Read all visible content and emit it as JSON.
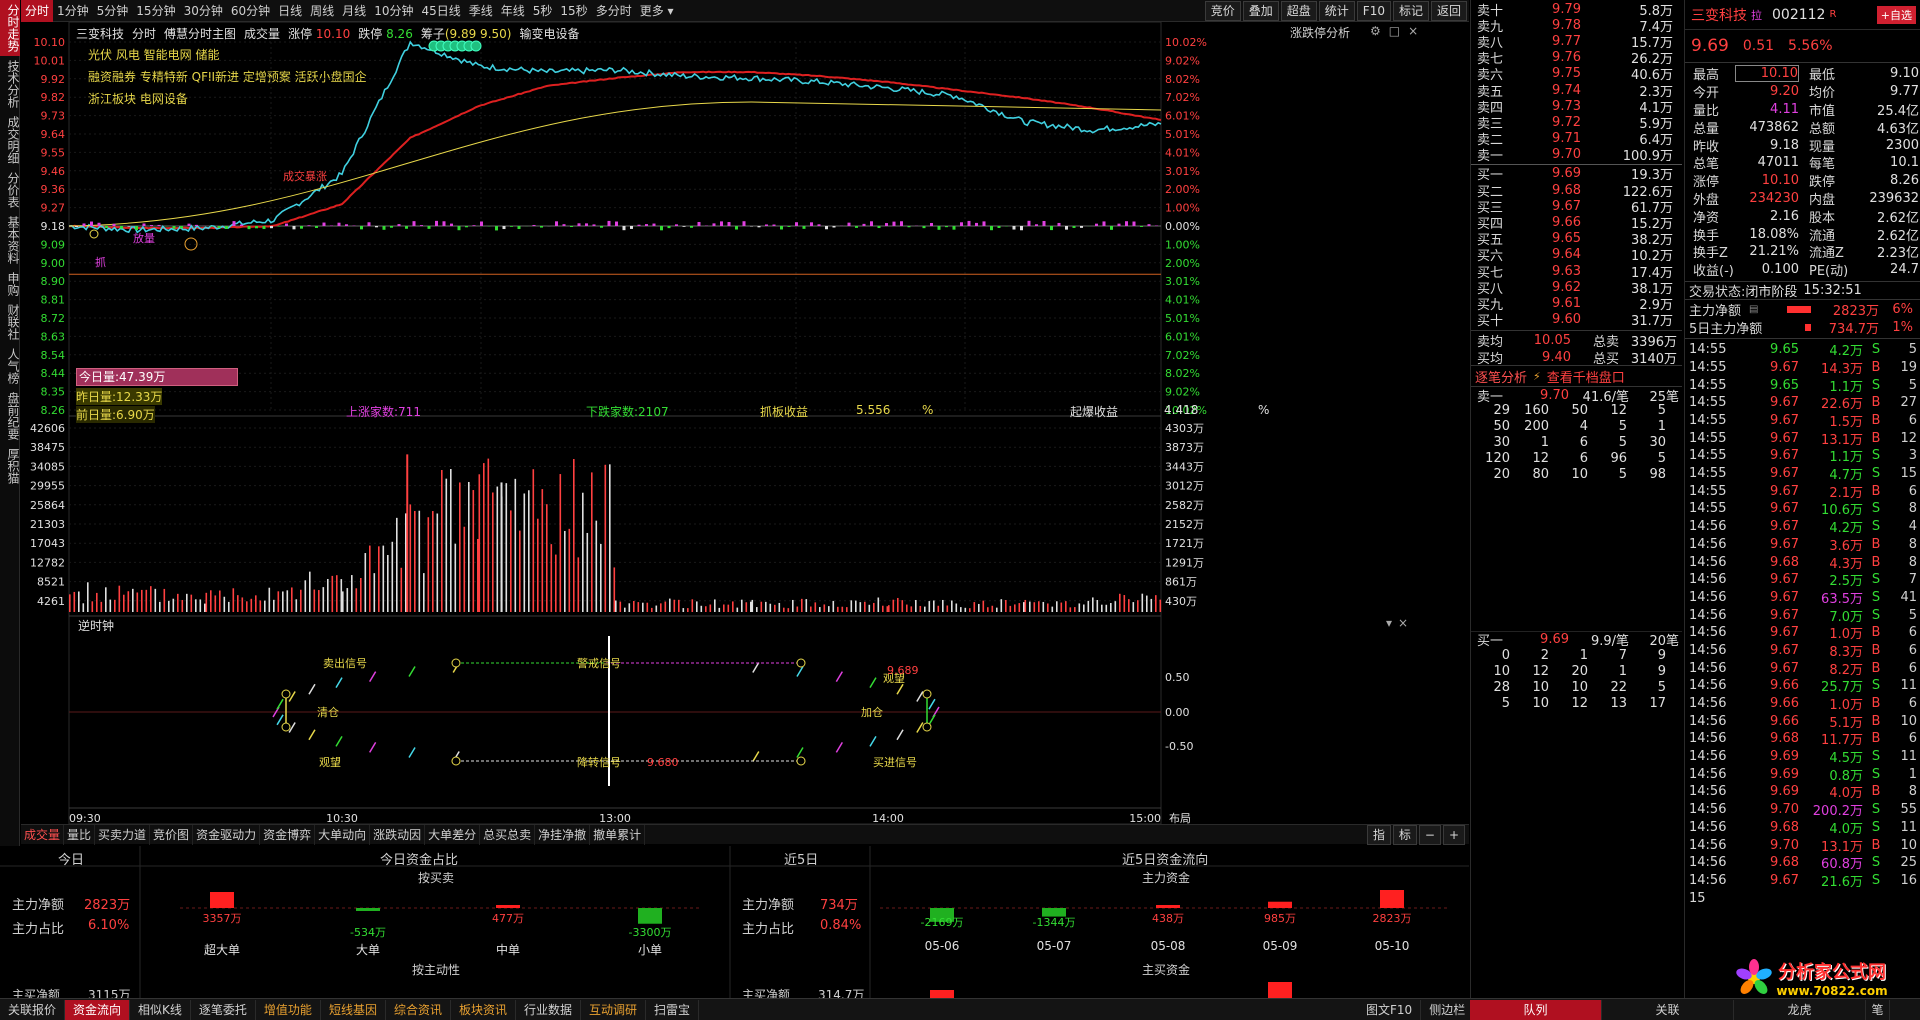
{
  "vtabs": [
    {
      "label": "分时走势",
      "active": true
    },
    {
      "label": "技术分析"
    },
    {
      "label": "成交明细"
    },
    {
      "label": "分价表"
    },
    {
      "label": "基本资料"
    },
    {
      "label": "申购"
    },
    {
      "label": "财联社"
    },
    {
      "label": "人气榜"
    },
    {
      "label": "盘前纪要"
    },
    {
      "label": "厚积猫"
    }
  ],
  "periods": [
    {
      "label": "分时",
      "active": true
    },
    {
      "label": "1分钟"
    },
    {
      "label": "5分钟"
    },
    {
      "label": "15分钟"
    },
    {
      "label": "30分钟"
    },
    {
      "label": "60分钟"
    },
    {
      "label": "日线"
    },
    {
      "label": "周线"
    },
    {
      "label": "月线"
    },
    {
      "label": "10分钟"
    },
    {
      "label": "45日线"
    },
    {
      "label": "季线"
    },
    {
      "label": "年线"
    },
    {
      "label": "5秒"
    },
    {
      "label": "15秒"
    },
    {
      "label": "多分时"
    },
    {
      "label": "更多 ▾"
    }
  ],
  "right_buttons": [
    "竞价",
    "叠加",
    "超盘",
    "统计",
    "F10",
    "标记",
    "返回"
  ],
  "info": {
    "name": "三变科技",
    "mode": "分时",
    "main": "傅慧分时主图",
    "vol": "成交量",
    "zt_label": "涨停",
    "zt": "10.10",
    "dt_label": "跌停",
    "dt": "8.26",
    "chip_label": "筹子",
    "chip": "(9.89 9.50)",
    "industry": "输变电设备",
    "zdt": "涨跌停分析"
  },
  "tags": [
    "光伏 风电 智能电网 储能",
    "融资融券 专精特新 QFII新进 定增预案 活跃小盘国企",
    "浙江板块 电网设备"
  ],
  "chart_data": [
    {
      "type": "line",
      "title": "三变科技 分时",
      "x": [
        "09:30",
        "09:45",
        "10:00",
        "10:15",
        "10:30",
        "10:45",
        "11:00",
        "11:15",
        "11:30",
        "13:15",
        "13:30",
        "13:45",
        "14:00",
        "14:15",
        "14:30",
        "14:45",
        "15:00"
      ],
      "series": [
        {
          "name": "价格",
          "values": [
            9.18,
            9.16,
            9.17,
            9.21,
            9.44,
            10.1,
            9.98,
            9.95,
            9.96,
            9.93,
            9.92,
            9.9,
            9.87,
            9.83,
            9.7,
            9.66,
            9.69
          ]
        },
        {
          "name": "均价",
          "values": [
            9.18,
            9.17,
            9.17,
            9.18,
            9.29,
            9.62,
            9.78,
            9.88,
            9.92,
            9.95,
            9.95,
            9.93,
            9.9,
            9.86,
            9.82,
            9.77,
            9.71
          ]
        }
      ],
      "y_ticks": [
        "10.10",
        "10.01",
        "9.92",
        "9.82",
        "9.73",
        "9.64",
        "9.55",
        "9.46",
        "9.36",
        "9.27",
        "9.18",
        "9.09",
        "9.00",
        "8.90",
        "8.81",
        "8.72",
        "8.63",
        "8.54",
        "8.44",
        "8.35",
        "8.26"
      ],
      "y_pct_ticks": [
        "10.02%",
        "9.02%",
        "8.02%",
        "7.02%",
        "6.01%",
        "5.01%",
        "4.01%",
        "3.01%",
        "2.00%",
        "1.00%",
        "0.00%",
        "1.00%",
        "2.00%",
        "3.01%",
        "4.01%",
        "5.01%",
        "6.01%",
        "7.02%",
        "8.02%",
        "9.02%",
        "10.02%"
      ],
      "ylim": [
        8.26,
        10.1
      ]
    },
    {
      "type": "bar",
      "title": "成交量",
      "x": [
        "09:30",
        "10:00",
        "10:30",
        "11:00",
        "11:30",
        "13:00",
        "13:30",
        "14:00",
        "14:30",
        "15:00"
      ],
      "values": [
        6500,
        5200,
        9800,
        38000,
        31000,
        3000,
        2600,
        3100,
        2800,
        4800
      ],
      "y_ticks": [
        "42606",
        "38475",
        "34085",
        "29955",
        "25864",
        "21303",
        "17043",
        "12782",
        "8521",
        "4261"
      ],
      "y_right_ticks": [
        "4303万",
        "3873万",
        "3443万",
        "3012万",
        "2582万",
        "2152万",
        "1721万",
        "1291万",
        "861万",
        "430万"
      ]
    },
    {
      "type": "line",
      "title": "逆时钟",
      "y_ticks": [
        "0.50",
        "0.00",
        "-0.50"
      ]
    }
  ],
  "x_ticks": [
    "09:30",
    "10:30",
    "13:00",
    "14:00",
    "15:00"
  ],
  "x_right": "布局",
  "vol_labels": {
    "today": "今日量:47.39万",
    "yday": "昨日量:12.33万",
    "before": "前日量:6.90万"
  },
  "stats": {
    "up": "上涨家数:711",
    "down": "下跌家数:2107",
    "grab_label": "抓板收益",
    "grab": "5.556",
    "grab_unit": "%",
    "qb_label": "起爆收益",
    "qb": "4.418",
    "qb_unit": "%"
  },
  "osc": {
    "sell_sig": "卖出信号",
    "warn_sig": "警戒信号",
    "clear": "清仓",
    "add": "加仓",
    "watch1": "观望",
    "watch2": "观望",
    "down_sig": "降转信号",
    "buy_sig": "买进信号",
    "v1": "9.689",
    "v2": "9.680"
  },
  "chart_annotations": [
    "三变科技",
    "放量",
    "抓",
    "成交暴涨"
  ],
  "btabs": [
    {
      "label": "成交量",
      "active": true
    },
    {
      "label": "量比"
    },
    {
      "label": "买卖力道"
    },
    {
      "label": "竞价图"
    },
    {
      "label": "资金驱动力"
    },
    {
      "label": "资金博弈"
    },
    {
      "label": "大单动向"
    },
    {
      "label": "涨跌动因"
    },
    {
      "label": "大单差分"
    },
    {
      "label": "总买总卖"
    },
    {
      "label": "净挂净撤"
    },
    {
      "label": "撤单累计"
    }
  ],
  "btab_right": [
    "指",
    "标",
    "−",
    "+"
  ],
  "flow": {
    "today": "今日",
    "ratio_title": "今日资金占比",
    "by_buy": "按买卖",
    "by_active": "按主动性",
    "main_net_label": "主力净额",
    "main_net": "2823万",
    "main_pct_label": "主力占比",
    "main_pct": "6.10%",
    "bars": [
      {
        "label": "超大单",
        "value": "3357万"
      },
      {
        "label": "大单",
        "value": "-534万"
      },
      {
        "label": "中单",
        "value": "477万"
      },
      {
        "label": "小单",
        "value": "-3300万"
      }
    ],
    "d5": "近5日",
    "d5_flow": "近5日资金流向",
    "d5_main": "主力资金",
    "d5_net_label": "主力净额",
    "d5_net": "734万",
    "d5_pct_label": "主力占比",
    "d5_pct": "0.84%",
    "d5_bars": [
      {
        "label": "05-06",
        "value": "-2169万"
      },
      {
        "label": "05-07",
        "value": "-1344万"
      },
      {
        "label": "05-08",
        "value": "438万"
      },
      {
        "label": "05-09",
        "value": "985万"
      },
      {
        "label": "05-10",
        "value": "2823万"
      }
    ],
    "main_active": "主买资金",
    "partial1": "主买净额",
    "partial2": "3115万",
    "partial3": "主买净额",
    "partial4": "314.7万"
  },
  "statusbar": [
    {
      "label": "关联报价"
    },
    {
      "label": "资金流向",
      "active": true
    },
    {
      "label": "相似K线"
    },
    {
      "label": "逐笔委托"
    },
    {
      "label": "增值功能",
      "y": true
    },
    {
      "label": "短线基因",
      "y": true
    },
    {
      "label": "综合资讯",
      "y": true
    },
    {
      "label": "板块资讯",
      "y": true
    },
    {
      "label": "行业数据"
    },
    {
      "label": "互动调研",
      "y": true
    },
    {
      "label": "扫雷宝"
    }
  ],
  "statusbar_right": [
    "图文F10",
    "侧边栏"
  ],
  "asks": [
    {
      "l": "卖十",
      "p": "9.79",
      "v": "5.8万"
    },
    {
      "l": "卖九",
      "p": "9.78",
      "v": "7.4万"
    },
    {
      "l": "卖八",
      "p": "9.77",
      "v": "15.7万"
    },
    {
      "l": "卖七",
      "p": "9.76",
      "v": "26.2万"
    },
    {
      "l": "卖六",
      "p": "9.75",
      "v": "40.6万"
    },
    {
      "l": "卖五",
      "p": "9.74",
      "v": "2.3万"
    },
    {
      "l": "卖四",
      "p": "9.73",
      "v": "4.1万"
    },
    {
      "l": "卖三",
      "p": "9.72",
      "v": "5.9万"
    },
    {
      "l": "卖二",
      "p": "9.71",
      "v": "6.4万"
    },
    {
      "l": "卖一",
      "p": "9.70",
      "v": "100.9万"
    }
  ],
  "bids": [
    {
      "l": "买一",
      "p": "9.69",
      "v": "19.3万"
    },
    {
      "l": "买二",
      "p": "9.68",
      "v": "122.6万"
    },
    {
      "l": "买三",
      "p": "9.67",
      "v": "61.7万"
    },
    {
      "l": "买四",
      "p": "9.66",
      "v": "15.2万"
    },
    {
      "l": "买五",
      "p": "9.65",
      "v": "38.2万"
    },
    {
      "l": "买六",
      "p": "9.64",
      "v": "10.2万"
    },
    {
      "l": "买七",
      "p": "9.63",
      "v": "17.4万"
    },
    {
      "l": "买八",
      "p": "9.62",
      "v": "38.1万"
    },
    {
      "l": "买九",
      "p": "9.61",
      "v": "2.9万"
    },
    {
      "l": "买十",
      "p": "9.60",
      "v": "31.7万"
    }
  ],
  "avg": {
    "sell_l": "卖均",
    "sell": "10.05",
    "tsell_l": "总卖",
    "tsell": "3396万",
    "buy_l": "买均",
    "buy": "9.40",
    "tbuy_l": "总买",
    "tbuy": "3140万"
  },
  "zb": {
    "title": "逐笔分析",
    "link": "查看千档盘口",
    "s1_l": "卖一",
    "s1_p": "9.70",
    "s1_avg": "41.6/笔",
    "s1_n": "25笔",
    "s1_rows": [
      [
        "29",
        "160",
        "50",
        "12",
        "5"
      ],
      [
        "50",
        "200",
        "4",
        "5",
        "1"
      ],
      [
        "30",
        "1",
        "6",
        "5",
        "30"
      ],
      [
        "120",
        "12",
        "6",
        "96",
        "5"
      ],
      [
        "20",
        "80",
        "10",
        "5",
        "98"
      ]
    ],
    "b1_l": "买一",
    "b1_p": "9.69",
    "b1_avg": "9.9/笔",
    "b1_n": "20笔",
    "b1_rows": [
      [
        "0",
        "2",
        "1",
        "7",
        "9"
      ],
      [
        "10",
        "12",
        "20",
        "1",
        "9"
      ],
      [
        "28",
        "10",
        "10",
        "22",
        "5"
      ],
      [
        "5",
        "10",
        "12",
        "13",
        "17"
      ]
    ]
  },
  "quote": {
    "name": "三变科技",
    "tag": "拉",
    "code": "002112",
    "flag": "R",
    "add": "+自选",
    "price": "9.69",
    "chg": "0.51",
    "pct": "5.56%",
    "rows": [
      [
        "最高",
        "10.10",
        "red",
        "最低",
        "9.10",
        "red"
      ],
      [
        "今开",
        "9.20",
        "red",
        "均价",
        "9.77",
        "red"
      ],
      [
        "量比",
        "4.11",
        "mag",
        "市值",
        "25.4亿",
        "white"
      ],
      [
        "总量",
        "473862",
        "white",
        "总额",
        "4.63亿",
        "cyan"
      ],
      [
        "昨收",
        "9.18",
        "white",
        "现量",
        "2300",
        "mag"
      ],
      [
        "总笔",
        "47011",
        "white",
        "每笔",
        "10.1",
        "white"
      ],
      [
        "涨停",
        "10.10",
        "red",
        "跌停",
        "8.26",
        "green"
      ],
      [
        "外盘",
        "234230",
        "red",
        "内盘",
        "239632",
        "green"
      ],
      [
        "净资",
        "2.16",
        "white",
        "股本",
        "2.62亿",
        "white"
      ],
      [
        "换手",
        "18.08%",
        "white",
        "流通",
        "2.62亿",
        "white"
      ],
      [
        "换手Z",
        "21.21%",
        "white",
        "流通Z",
        "2.23亿",
        "white"
      ],
      [
        "收益(-)",
        "0.100",
        "white",
        "PE(动)",
        "24.7",
        "white"
      ]
    ],
    "state_l": "交易状态:",
    "state": "闭市阶段",
    "time": "15:32:51",
    "mn_l": "主力净额",
    "mn": "2823万",
    "mn_p": "6%",
    "m5_l": "5日主力净额",
    "m5": "734.7万",
    "m5_p": "1%"
  },
  "ticks": [
    [
      "14:55",
      "9.65",
      "4.2万",
      "S",
      "5"
    ],
    [
      "14:55",
      "9.67",
      "14.3万",
      "B",
      "19"
    ],
    [
      "14:55",
      "9.65",
      "1.1万",
      "S",
      "5"
    ],
    [
      "14:55",
      "9.67",
      "22.6万",
      "B",
      "27"
    ],
    [
      "14:55",
      "9.67",
      "1.5万",
      "B",
      "6"
    ],
    [
      "14:55",
      "9.67",
      "13.1万",
      "B",
      "12"
    ],
    [
      "14:55",
      "9.67",
      "1.1万",
      "S",
      "3"
    ],
    [
      "14:55",
      "9.67",
      "4.7万",
      "S",
      "15"
    ],
    [
      "14:55",
      "9.67",
      "2.1万",
      "B",
      "6"
    ],
    [
      "14:55",
      "9.67",
      "10.6万",
      "S",
      "8"
    ],
    [
      "14:56",
      "9.67",
      "4.2万",
      "S",
      "4"
    ],
    [
      "14:56",
      "9.67",
      "3.6万",
      "B",
      "8"
    ],
    [
      "14:56",
      "9.68",
      "4.3万",
      "B",
      "8"
    ],
    [
      "14:56",
      "9.67",
      "2.5万",
      "S",
      "7"
    ],
    [
      "14:56",
      "9.67",
      "63.5万",
      "S",
      "41"
    ],
    [
      "14:56",
      "9.67",
      "7.0万",
      "S",
      "5"
    ],
    [
      "14:56",
      "9.67",
      "1.0万",
      "B",
      "6"
    ],
    [
      "14:56",
      "9.67",
      "8.3万",
      "B",
      "6"
    ],
    [
      "14:56",
      "9.67",
      "8.2万",
      "B",
      "6"
    ],
    [
      "14:56",
      "9.66",
      "25.7万",
      "S",
      "11"
    ],
    [
      "14:56",
      "9.66",
      "1.0万",
      "B",
      "6"
    ],
    [
      "14:56",
      "9.66",
      "5.1万",
      "B",
      "10"
    ],
    [
      "14:56",
      "9.68",
      "11.7万",
      "B",
      "6"
    ],
    [
      "14:56",
      "9.69",
      "4.5万",
      "S",
      "11"
    ],
    [
      "14:56",
      "9.69",
      "0.8万",
      "S",
      "1"
    ],
    [
      "14:56",
      "9.69",
      "4.0万",
      "B",
      "8"
    ],
    [
      "14:56",
      "9.70",
      "200.2万",
      "S",
      "55"
    ],
    [
      "14:56",
      "9.68",
      "4.0万",
      "S",
      "11"
    ],
    [
      "14:56",
      "9.70",
      "13.1万",
      "B",
      "10"
    ],
    [
      "14:56",
      "9.68",
      "60.8万",
      "S",
      "25"
    ],
    [
      "14:56",
      "9.67",
      "21.6万",
      "S",
      "16"
    ],
    [
      "15",
      "",
      "",
      "",
      ""
    ]
  ],
  "ticks_tabs": [
    "队列",
    "关联",
    "龙虎",
    "笔"
  ],
  "logo": {
    "cn": "分析家公式网",
    "url": "www.70822.com"
  }
}
